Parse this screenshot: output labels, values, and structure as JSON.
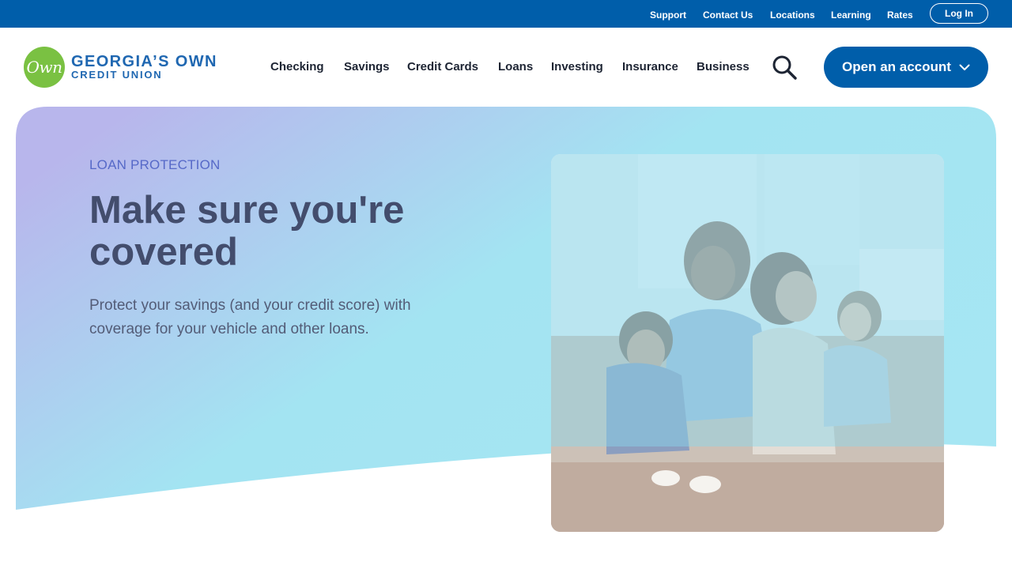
{
  "utility_nav": {
    "support": "Support",
    "contact": "Contact Us",
    "locations": "Locations",
    "learning": "Learning",
    "rates": "Rates",
    "login": "Log In"
  },
  "logo": {
    "badge": "Own",
    "line1": "GEORGIA’S OWN",
    "line2": "CREDIT UNION"
  },
  "main_nav": {
    "checking": "Checking",
    "savings": "Savings",
    "credit_cards": "Credit Cards",
    "loans": "Loans",
    "investing": "Investing",
    "insurance": "Insurance",
    "business": "Business"
  },
  "cta": {
    "open_account": "Open an account"
  },
  "hero": {
    "eyebrow": "LOAN PROTECTION",
    "title": "Make sure you're covered",
    "body": "Protect your savings (and your credit score) with coverage for your vehicle and other loans."
  },
  "colors": {
    "brand_blue": "#005eaa",
    "logo_green": "#7ac142",
    "gradient_start": "#b8b6ec",
    "gradient_end": "#a3e4f2",
    "eyebrow_blue": "#5669c8"
  },
  "icons": {
    "search": "search-icon",
    "chevron": "chevron-down-icon"
  }
}
